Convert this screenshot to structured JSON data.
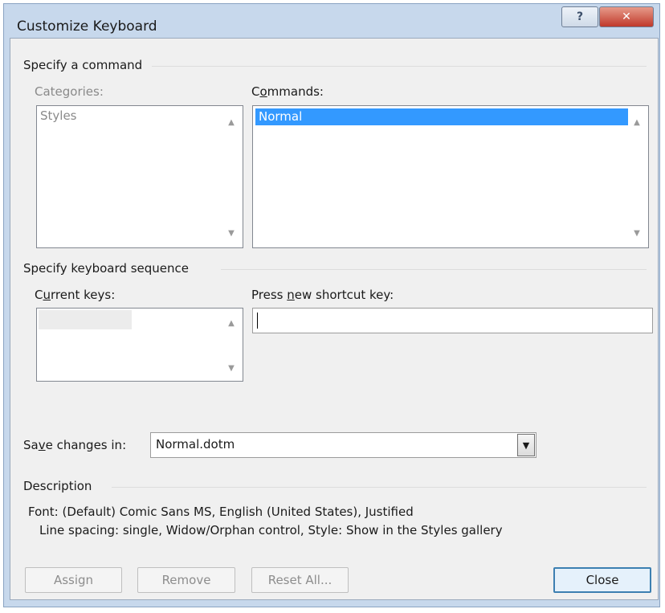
{
  "window": {
    "title": "Customize Keyboard",
    "help_icon": "help-icon",
    "close_icon": "close-icon"
  },
  "specify_command": {
    "group_label": "Specify a command",
    "categories_label": "Categories:",
    "categories": [
      "Styles"
    ],
    "commands_label_prefix": "C",
    "commands_label_accel": "o",
    "commands_label_rest": "mmands:",
    "commands": [
      "Normal"
    ]
  },
  "keyboard_sequence": {
    "group_label": "Specify keyboard sequence",
    "current_keys_prefix": "C",
    "current_keys_accel": "u",
    "current_keys_rest": "rrent keys:",
    "new_key_prefix": "Press ",
    "new_key_accel": "n",
    "new_key_rest": "ew shortcut key:",
    "new_key_value": ""
  },
  "save": {
    "label_prefix": "Sa",
    "label_accel": "v",
    "label_rest": "e changes in:",
    "value": "Normal.dotm"
  },
  "description": {
    "group_label": "Description",
    "line1": "Font: (Default) Comic Sans MS, English (United States), Justified",
    "line2": "Line spacing:  single, Widow/Orphan control, Style: Show in the Styles gallery"
  },
  "buttons": {
    "assign": "Assign",
    "remove": "Remove",
    "reset_all": "Reset All...",
    "close": "Close"
  },
  "colors": {
    "selection": "#3399ff",
    "frame": "#c7d8ec",
    "close_button": "#c0392b",
    "default_button_border": "#3c7fb1"
  }
}
